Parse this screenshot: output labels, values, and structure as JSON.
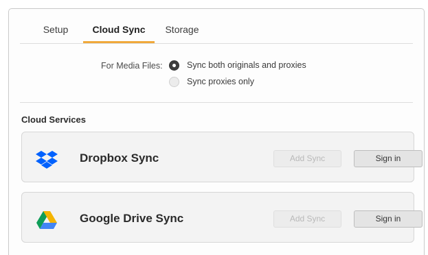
{
  "tabs": [
    {
      "label": "Setup",
      "active": false
    },
    {
      "label": "Cloud Sync",
      "active": true
    },
    {
      "label": "Storage",
      "active": false
    }
  ],
  "media": {
    "label": "For Media Files:",
    "options": [
      {
        "label": "Sync both originals and proxies",
        "selected": true
      },
      {
        "label": "Sync proxies only",
        "selected": false
      }
    ]
  },
  "cloud_services": {
    "title": "Cloud Services",
    "services": [
      {
        "name": "Dropbox Sync",
        "icon": "dropbox-icon",
        "add_label": "Add Sync",
        "add_enabled": false,
        "signin_label": "Sign in"
      },
      {
        "name": "Google Drive Sync",
        "icon": "google-drive-icon",
        "add_label": "Add Sync",
        "add_enabled": false,
        "signin_label": "Sign in"
      }
    ]
  },
  "colors": {
    "accent": "#f0a93a",
    "dropbox_blue": "#0061fe",
    "gdrive_blue": "#4285f4",
    "gdrive_green": "#0f9d58",
    "gdrive_yellow": "#f4b400"
  }
}
